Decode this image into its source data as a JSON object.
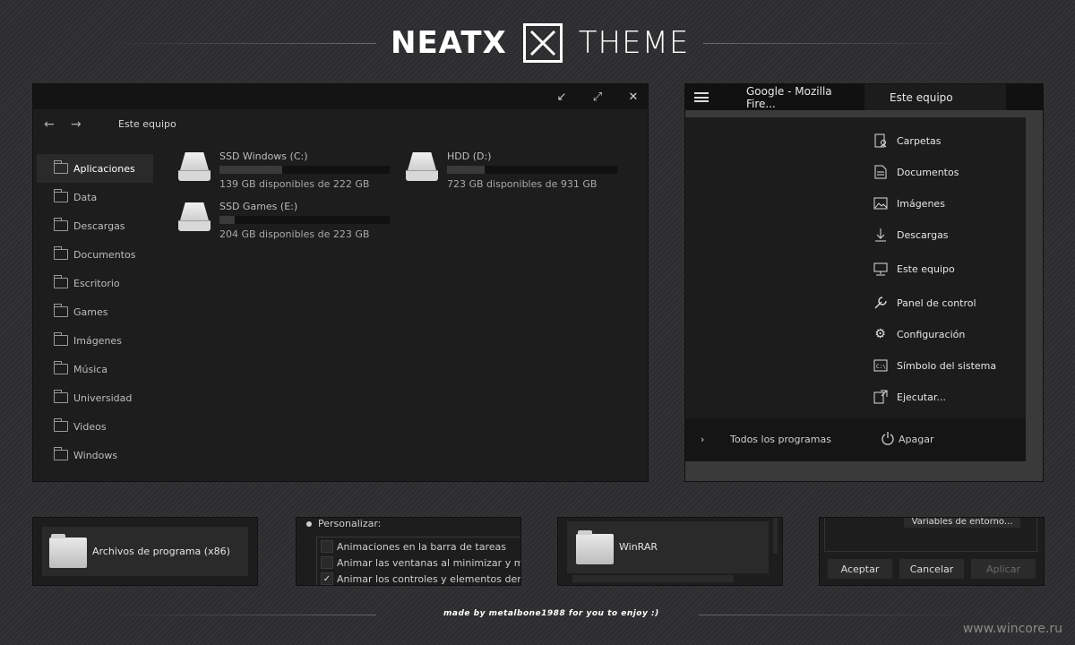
{
  "header": {
    "brand_left": "NEATX",
    "brand_right": "THEME"
  },
  "explorer": {
    "breadcrumb": "Este equipo",
    "sidebar": [
      {
        "label": "Aplicaciones",
        "active": true
      },
      {
        "label": "Data"
      },
      {
        "label": "Descargas"
      },
      {
        "label": "Documentos"
      },
      {
        "label": "Escritorio"
      },
      {
        "label": "Games"
      },
      {
        "label": "Imágenes"
      },
      {
        "label": "Música"
      },
      {
        "label": "Universidad"
      },
      {
        "label": "Videos"
      },
      {
        "label": "Windows"
      }
    ],
    "drives": [
      {
        "name": "SSD Windows (C:)",
        "free_text": "139 GB disponibles de 222 GB",
        "used_fraction": 0.37
      },
      {
        "name": "HDD (D:)",
        "free_text": "723 GB disponibles de 931 GB",
        "used_fraction": 0.22
      },
      {
        "name": "SSD Games (E:)",
        "free_text": "204 GB disponibles de 223 GB",
        "used_fraction": 0.09
      }
    ]
  },
  "startmenu": {
    "tab_browser": "Google - Mozilla Fire...",
    "tab_explorer": "Este equipo",
    "items": [
      {
        "label": "Carpetas",
        "icon": "person-folder-icon"
      },
      {
        "label": "Documentos",
        "icon": "document-icon"
      },
      {
        "label": "Imágenes",
        "icon": "image-icon"
      },
      {
        "label": "Descargas",
        "icon": "download-icon"
      },
      {
        "label": "Este equipo",
        "icon": "monitor-icon"
      },
      {
        "label": "Panel de control",
        "icon": "wrench-icon"
      },
      {
        "label": "Configuración",
        "icon": "gear-icon"
      },
      {
        "label": "Símbolo del sistema",
        "icon": "terminal-icon"
      },
      {
        "label": "Ejecutar...",
        "icon": "run-icon"
      }
    ],
    "all_programs": "Todos los programas",
    "shutdown": "Apagar"
  },
  "thumbs": {
    "folder1_label": "Archivos de programa (x86)",
    "personalize_label": "Personalizar:",
    "checkboxes": [
      {
        "label": "Animaciones en la barra de tareas",
        "checked": false
      },
      {
        "label": "Animar las ventanas al minimizar y max",
        "checked": false
      },
      {
        "label": "Animar los controles y elementos dentr",
        "checked": true
      }
    ],
    "folder2_label": "WinRAR",
    "env_vars_label": "Variables de entorno...",
    "btn_accept": "Aceptar",
    "btn_cancel": "Cancelar",
    "btn_apply": "Aplicar"
  },
  "footer": {
    "credit": "made by metalbone1988 for you to enjoy :)",
    "watermark": "www.wincore.ru"
  }
}
